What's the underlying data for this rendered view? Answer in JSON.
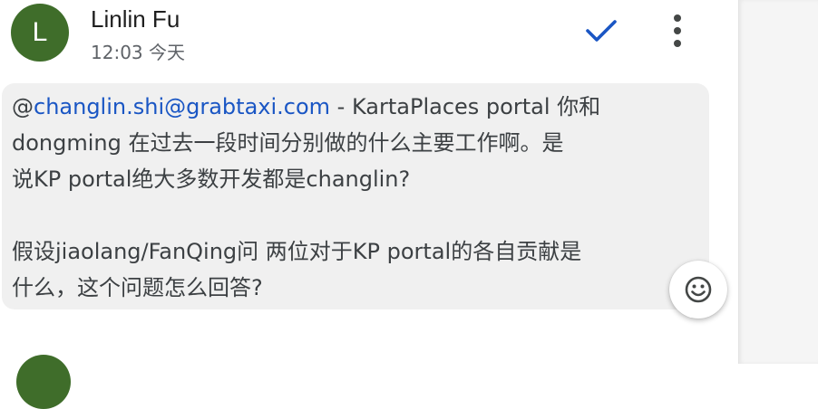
{
  "message": {
    "sender": {
      "initial": "L",
      "name": "Linlin Fu",
      "avatar_color": "#3f6d2a"
    },
    "timestamp": "12:03 今天",
    "actions": {
      "check_icon": "checkmark-icon",
      "more_icon": "more-vert-icon",
      "check_color": "#1a56c4"
    },
    "body": {
      "mention": "@",
      "mention_email": "changlin.shi@grabtaxi.com",
      "line1_rest": " - KartaPlaces portal 你和",
      "line2": "dongming 在过去一段时间分别做的什么主要工作啊。是",
      "line3": "说KP portal绝大多数开发都是changlin?",
      "line4": "假设jiaolang/FanQing问 两位对于KP portal的各自贡献是",
      "line5": "什么，这个问题怎么回答?"
    },
    "emoji_icon": "emoji-smile-icon"
  },
  "next_message": {
    "avatar_color": "#3f6d2a"
  }
}
